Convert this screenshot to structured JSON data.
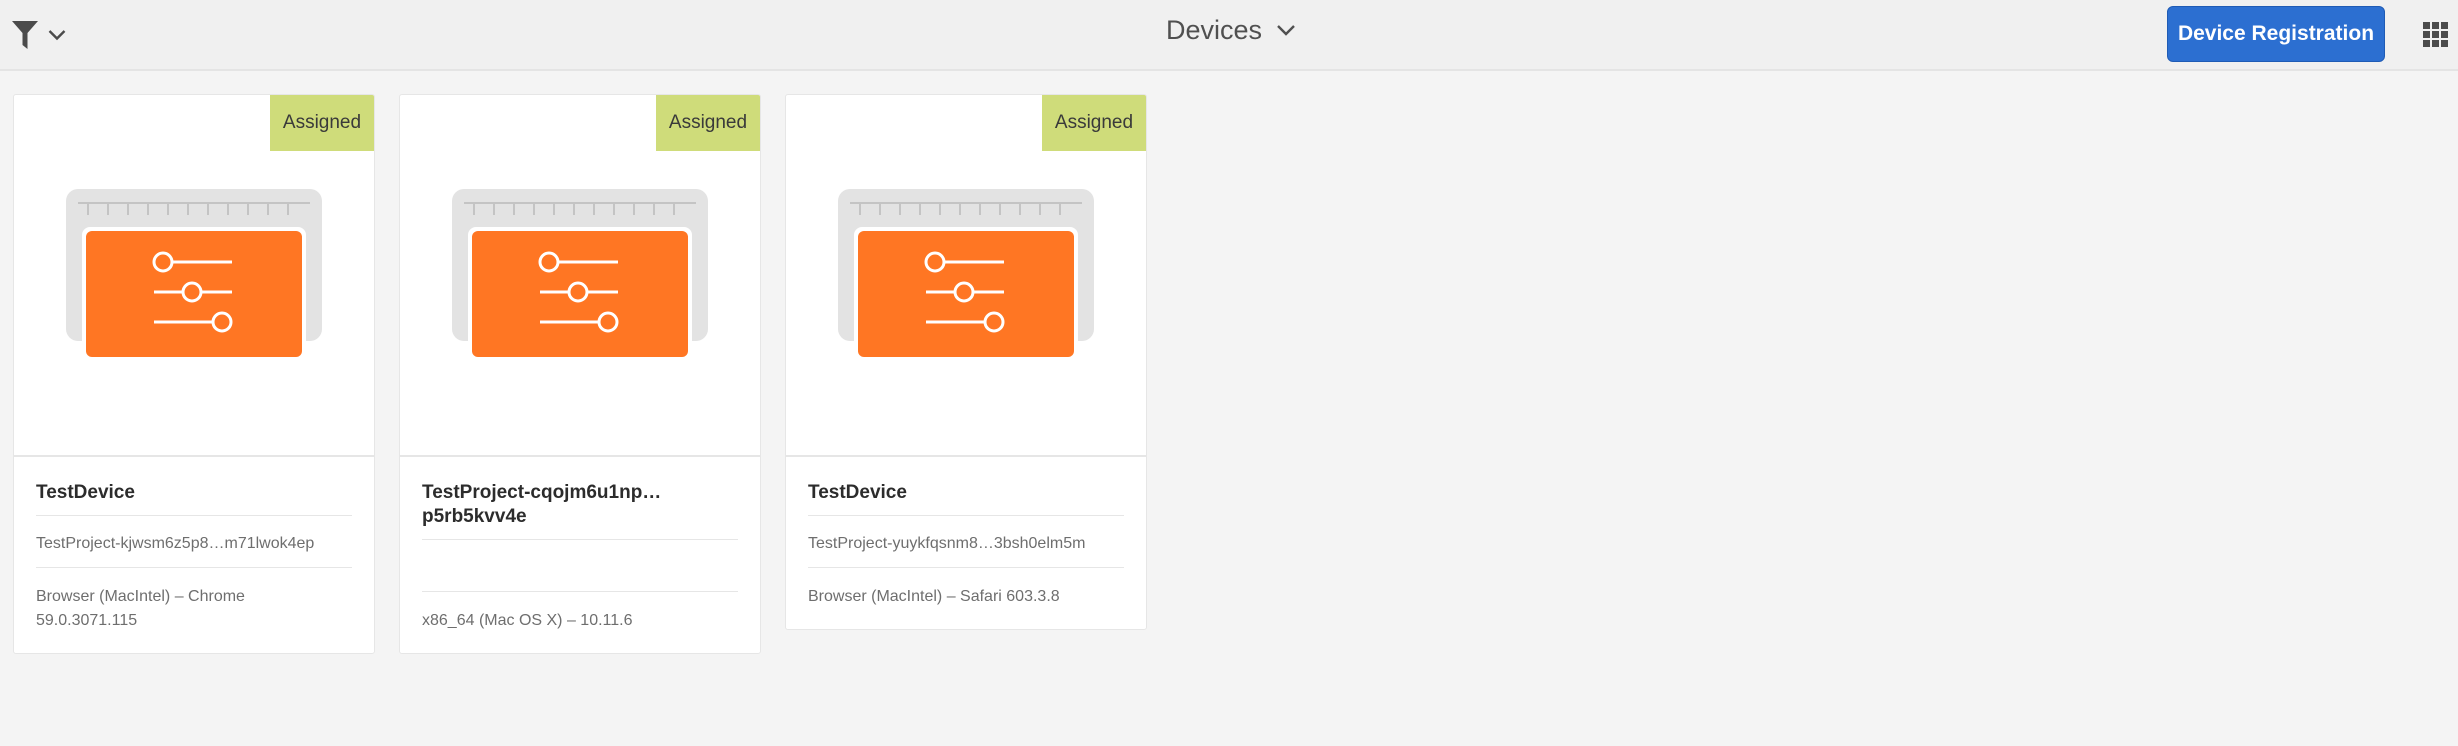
{
  "header": {
    "title": "Devices",
    "registration_button": "Device Registration"
  },
  "colors": {
    "accent": "#2c6fd1",
    "badge": "#cfdc7a",
    "tile_orange": "#ff7623"
  },
  "cards": [
    {
      "status": "Assigned",
      "name": "TestDevice",
      "project": "TestProject-kjwsm6z5p8…m71lwok4ep",
      "browser_line1": "Browser (MacIntel) – Chrome",
      "browser_line2": "59.0.3071.115"
    },
    {
      "status": "Assigned",
      "name_line1": "TestProject-cqojm6u1np…",
      "name_line2": "p5rb5kvv4e",
      "project": "",
      "browser_line1": "x86_64 (Mac OS X) – 10.11.6"
    },
    {
      "status": "Assigned",
      "name": "TestDevice",
      "project": "TestProject-yuykfqsnm8…3bsh0elm5m",
      "browser_line1": "Browser (MacIntel) – Safari 603.3.8"
    }
  ]
}
